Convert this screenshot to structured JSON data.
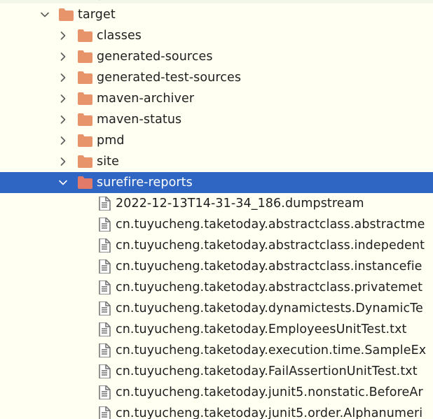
{
  "project_tree": {
    "root": {
      "label": "target",
      "icon": "folder-icon",
      "expanded": true
    },
    "folders": [
      {
        "label": "classes",
        "icon": "folder-icon",
        "expanded": false
      },
      {
        "label": "generated-sources",
        "icon": "folder-icon",
        "expanded": false
      },
      {
        "label": "generated-test-sources",
        "icon": "folder-icon",
        "expanded": false
      },
      {
        "label": "maven-archiver",
        "icon": "folder-icon",
        "expanded": false
      },
      {
        "label": "maven-status",
        "icon": "folder-icon",
        "expanded": false
      },
      {
        "label": "pmd",
        "icon": "folder-icon",
        "expanded": false
      },
      {
        "label": "site",
        "icon": "folder-icon",
        "expanded": false
      },
      {
        "label": "surefire-reports",
        "icon": "folder-icon",
        "expanded": true,
        "selected": true
      }
    ],
    "files": [
      {
        "label": "2022-12-13T14-31-34_186.dumpstream",
        "icon": "text-file-icon"
      },
      {
        "label": "cn.tuyucheng.taketoday.abstractclass.abstractme",
        "icon": "text-file-icon"
      },
      {
        "label": "cn.tuyucheng.taketoday.abstractclass.indepedent",
        "icon": "text-file-icon"
      },
      {
        "label": "cn.tuyucheng.taketoday.abstractclass.instancefie",
        "icon": "text-file-icon"
      },
      {
        "label": "cn.tuyucheng.taketoday.abstractclass.privatemet",
        "icon": "text-file-icon"
      },
      {
        "label": "cn.tuyucheng.taketoday.dynamictests.DynamicTe",
        "icon": "text-file-icon"
      },
      {
        "label": "cn.tuyucheng.taketoday.EmployeesUnitTest.txt",
        "icon": "text-file-icon"
      },
      {
        "label": "cn.tuyucheng.taketoday.execution.time.SampleEx",
        "icon": "text-file-icon"
      },
      {
        "label": "cn.tuyucheng.taketoday.FailAssertionUnitTest.txt",
        "icon": "text-file-icon"
      },
      {
        "label": "cn.tuyucheng.taketoday.junit5.nonstatic.BeforeAr",
        "icon": "text-file-icon"
      },
      {
        "label": "cn.tuyucheng.taketoday.junit5.order.Alphanumeri",
        "icon": "text-file-icon"
      }
    ]
  },
  "colors": {
    "background": "#fffff2",
    "selection": "#2f65c3",
    "selected_text": "#ffffff",
    "text": "#1e1e1e",
    "folder": "#e8946a",
    "folder_selected": "#e27a6a",
    "file_icon": "#6e6e6e",
    "chevron": "#5a5a5a"
  }
}
